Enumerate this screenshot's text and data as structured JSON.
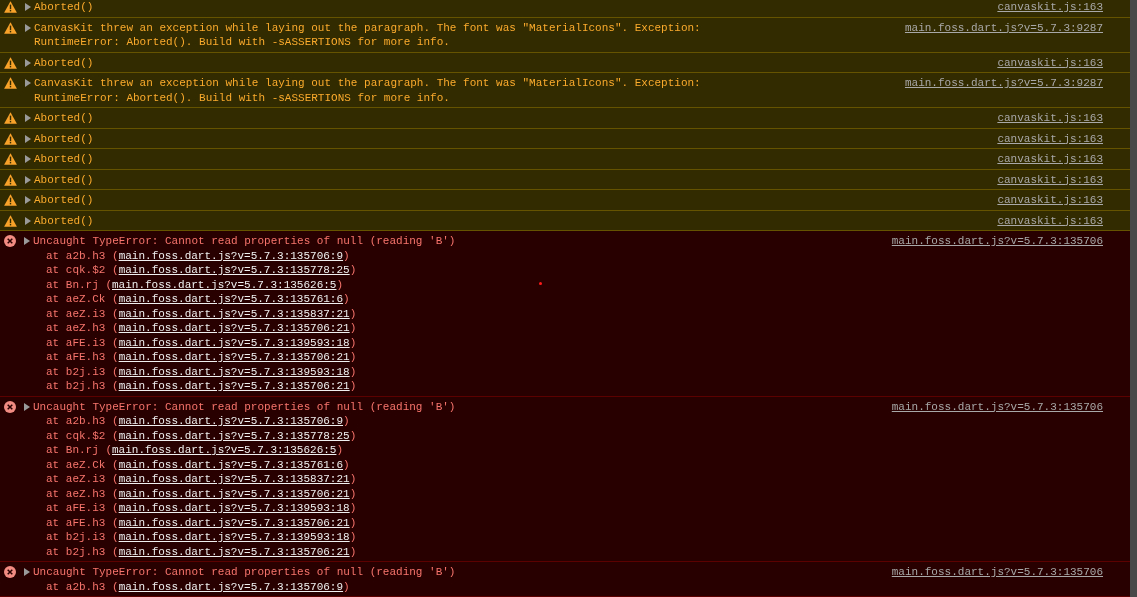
{
  "console": {
    "messages": [
      {
        "kind": "warning",
        "expanded": false,
        "text": "Aborted()",
        "source": "canvaskit.js:163"
      },
      {
        "kind": "warning",
        "expanded": false,
        "text": "CanvasKit threw an exception while laying out the paragraph. The font was \"MaterialIcons\". Exception:\nRuntimeError: Aborted(). Build with -sASSERTIONS for more info.",
        "source": "main.foss.dart.js?v=5.7.3:9287"
      },
      {
        "kind": "warning",
        "expanded": false,
        "text": "Aborted()",
        "source": "canvaskit.js:163"
      },
      {
        "kind": "warning",
        "expanded": false,
        "text": "CanvasKit threw an exception while laying out the paragraph. The font was \"MaterialIcons\". Exception:\nRuntimeError: Aborted(). Build with -sASSERTIONS for more info.",
        "source": "main.foss.dart.js?v=5.7.3:9287"
      },
      {
        "kind": "warning",
        "expanded": false,
        "text": "Aborted()",
        "source": "canvaskit.js:163"
      },
      {
        "kind": "warning",
        "expanded": false,
        "text": "Aborted()",
        "source": "canvaskit.js:163"
      },
      {
        "kind": "warning",
        "expanded": false,
        "text": "Aborted()",
        "source": "canvaskit.js:163"
      },
      {
        "kind": "warning",
        "expanded": false,
        "text": "Aborted()",
        "source": "canvaskit.js:163"
      },
      {
        "kind": "warning",
        "expanded": false,
        "text": "Aborted()",
        "source": "canvaskit.js:163"
      },
      {
        "kind": "warning",
        "expanded": false,
        "text": "Aborted()",
        "source": "canvaskit.js:163"
      },
      {
        "kind": "error",
        "expanded": false,
        "text": "Uncaught TypeError: Cannot read properties of null (reading 'B')",
        "source": "main.foss.dart.js?v=5.7.3:135706",
        "stack": [
          {
            "before": "at a2b.h3 (",
            "link": "main.foss.dart.js?v=5.7.3:135706:9",
            "after": ")"
          },
          {
            "before": "at cqk.$2 (",
            "link": "main.foss.dart.js?v=5.7.3:135778:25",
            "after": ")"
          },
          {
            "before": "at Bn.rj (",
            "link": "main.foss.dart.js?v=5.7.3:135626:5",
            "after": ")"
          },
          {
            "before": "at aeZ.Ck (",
            "link": "main.foss.dart.js?v=5.7.3:135761:6",
            "after": ")"
          },
          {
            "before": "at aeZ.i3 (",
            "link": "main.foss.dart.js?v=5.7.3:135837:21",
            "after": ")"
          },
          {
            "before": "at aeZ.h3 (",
            "link": "main.foss.dart.js?v=5.7.3:135706:21",
            "after": ")"
          },
          {
            "before": "at aFE.i3 (",
            "link": "main.foss.dart.js?v=5.7.3:139593:18",
            "after": ")"
          },
          {
            "before": "at aFE.h3 (",
            "link": "main.foss.dart.js?v=5.7.3:135706:21",
            "after": ")"
          },
          {
            "before": "at b2j.i3 (",
            "link": "main.foss.dart.js?v=5.7.3:139593:18",
            "after": ")"
          },
          {
            "before": "at b2j.h3 (",
            "link": "main.foss.dart.js?v=5.7.3:135706:21",
            "after": ")"
          }
        ]
      },
      {
        "kind": "error",
        "expanded": false,
        "text": "Uncaught TypeError: Cannot read properties of null (reading 'B')",
        "source": "main.foss.dart.js?v=5.7.3:135706",
        "stack": [
          {
            "before": "at a2b.h3 (",
            "link": "main.foss.dart.js?v=5.7.3:135706:9",
            "after": ")"
          },
          {
            "before": "at cqk.$2 (",
            "link": "main.foss.dart.js?v=5.7.3:135778:25",
            "after": ")"
          },
          {
            "before": "at Bn.rj (",
            "link": "main.foss.dart.js?v=5.7.3:135626:5",
            "after": ")"
          },
          {
            "before": "at aeZ.Ck (",
            "link": "main.foss.dart.js?v=5.7.3:135761:6",
            "after": ")"
          },
          {
            "before": "at aeZ.i3 (",
            "link": "main.foss.dart.js?v=5.7.3:135837:21",
            "after": ")"
          },
          {
            "before": "at aeZ.h3 (",
            "link": "main.foss.dart.js?v=5.7.3:135706:21",
            "after": ")"
          },
          {
            "before": "at aFE.i3 (",
            "link": "main.foss.dart.js?v=5.7.3:139593:18",
            "after": ")"
          },
          {
            "before": "at aFE.h3 (",
            "link": "main.foss.dart.js?v=5.7.3:135706:21",
            "after": ")"
          },
          {
            "before": "at b2j.i3 (",
            "link": "main.foss.dart.js?v=5.7.3:139593:18",
            "after": ")"
          },
          {
            "before": "at b2j.h3 (",
            "link": "main.foss.dart.js?v=5.7.3:135706:21",
            "after": ")"
          }
        ]
      },
      {
        "kind": "error",
        "expanded": false,
        "text": "Uncaught TypeError: Cannot read properties of null (reading 'B')",
        "source": "main.foss.dart.js?v=5.7.3:135706",
        "stack": [
          {
            "before": "at a2b.h3 (",
            "link": "main.foss.dart.js?v=5.7.3:135706:9",
            "after": ")"
          }
        ]
      }
    ]
  }
}
